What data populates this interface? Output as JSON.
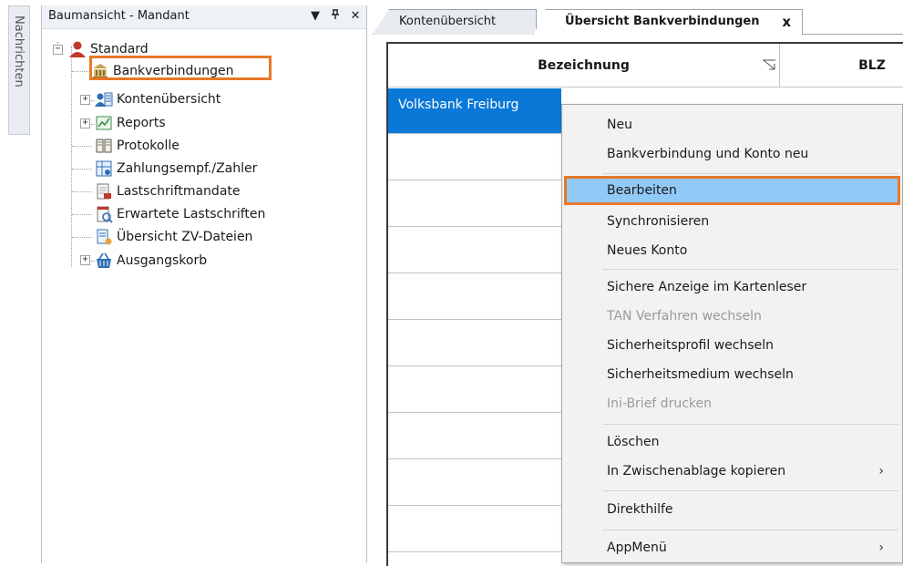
{
  "side_tab": {
    "label": "Nachrichten"
  },
  "tree_panel": {
    "title": "Baumansicht - Mandant",
    "buttons": {
      "dropdown": "▼",
      "pin": "ᵖ",
      "close": "✕"
    },
    "root": {
      "label": "Standard",
      "expander": "−"
    },
    "items": [
      {
        "label": "Bankverbindungen",
        "icon": "bank-icon"
      },
      {
        "label": "Kontenübersicht",
        "icon": "accounts-icon",
        "expander": "+"
      },
      {
        "label": "Reports",
        "icon": "reports-icon",
        "expander": "+"
      },
      {
        "label": "Protokolle",
        "icon": "book-icon"
      },
      {
        "label": "Zahlungsempf./Zahler",
        "icon": "payee-icon"
      },
      {
        "label": "Lastschriftmandate",
        "icon": "mandate-icon"
      },
      {
        "label": "Erwartete Lastschriften",
        "icon": "expected-debits-icon"
      },
      {
        "label": "Übersicht ZV-Dateien",
        "icon": "zv-files-icon"
      },
      {
        "label": "Ausgangskorb",
        "icon": "basket-icon",
        "expander": "+"
      }
    ]
  },
  "tabs": [
    {
      "label": "Kontenübersicht",
      "active": false
    },
    {
      "label": "Übersicht Bankverbindungen",
      "active": true,
      "close": "x"
    }
  ],
  "grid": {
    "columns": [
      "Bezeichnung",
      "BLZ"
    ],
    "rows": [
      {
        "bezeichnung": "Volksbank Freiburg",
        "selected": true
      }
    ]
  },
  "context_menu": {
    "groups": [
      [
        {
          "label": "Neu",
          "enabled": true
        },
        {
          "label": "Bankverbindung und Konto neu",
          "enabled": true
        }
      ],
      [
        {
          "label": "Bearbeiten",
          "enabled": true,
          "highlighted": true
        },
        {
          "label": "Synchronisieren",
          "enabled": true
        },
        {
          "label": "Neues Konto",
          "enabled": true
        }
      ],
      [
        {
          "label": "Sichere Anzeige im Kartenleser",
          "enabled": true
        },
        {
          "label": "TAN Verfahren wechseln",
          "enabled": false
        },
        {
          "label": "Sicherheitsprofil wechseln",
          "enabled": true
        },
        {
          "label": "Sicherheitsmedium wechseln",
          "enabled": true
        },
        {
          "label": "Ini-Brief drucken",
          "enabled": false
        }
      ],
      [
        {
          "label": "Löschen",
          "enabled": true
        },
        {
          "label": "In Zwischenablage kopieren",
          "enabled": true,
          "submenu": true
        }
      ],
      [
        {
          "label": "Direkthilfe",
          "enabled": true
        }
      ],
      [
        {
          "label": "AppMenü",
          "enabled": true,
          "submenu": true
        }
      ]
    ],
    "submenu_arrow": "›"
  },
  "colors": {
    "highlight_border": "#e8782a",
    "selected_row": "#0a78d7",
    "menu_highlight": "#91c9f7"
  }
}
